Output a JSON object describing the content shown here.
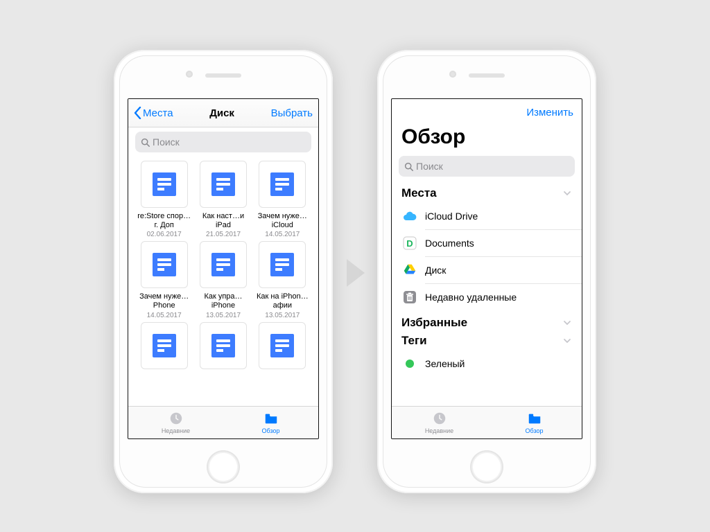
{
  "colors": {
    "tint": "#007aff",
    "gray": "#8e8e93"
  },
  "tabs": {
    "recent": "Недавние",
    "browse": "Обзор"
  },
  "left": {
    "back": "Места",
    "title": "Диск",
    "action": "Выбрать",
    "search_placeholder": "Поиск",
    "files": [
      {
        "name": "re:Store спор…г. Доп",
        "date": "02.06.2017"
      },
      {
        "name": "Как наст…и iPad",
        "date": "21.05.2017"
      },
      {
        "name": "Зачем нуже…iCloud",
        "date": "14.05.2017"
      },
      {
        "name": "Зачем нуже…Phone",
        "date": "14.05.2017"
      },
      {
        "name": "Как упра…iPhone",
        "date": "13.05.2017"
      },
      {
        "name": "Как на iPhon…афии",
        "date": "13.05.2017"
      }
    ]
  },
  "right": {
    "action": "Изменить",
    "title": "Обзор",
    "search_placeholder": "Поиск",
    "sections": {
      "locations": "Места",
      "favorites": "Избранные",
      "tags": "Теги"
    },
    "locations": [
      {
        "label": "iCloud Drive",
        "icon": "icloud"
      },
      {
        "label": "Documents",
        "icon": "documents"
      },
      {
        "label": "Диск",
        "icon": "gdrive"
      },
      {
        "label": "Недавно удаленные",
        "icon": "trash"
      }
    ],
    "tags": [
      {
        "label": "Зеленый",
        "color": "#34c759"
      }
    ]
  }
}
